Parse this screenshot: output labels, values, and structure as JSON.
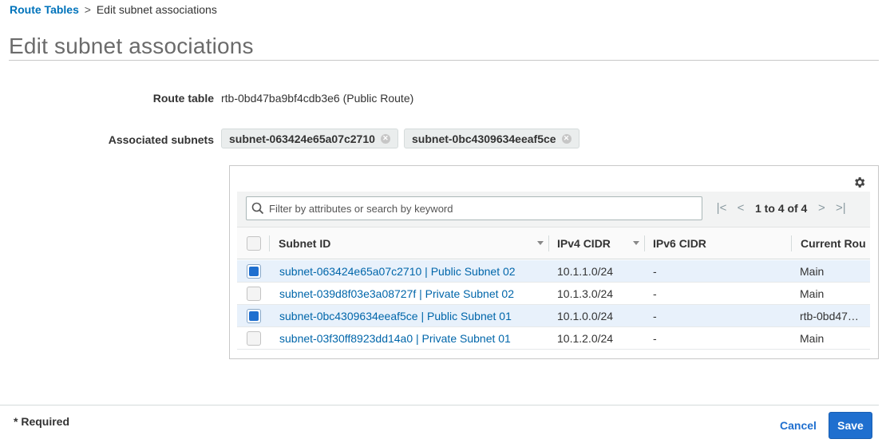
{
  "breadcrumb": {
    "parent": "Route Tables",
    "separator": ">",
    "current": "Edit subnet associations"
  },
  "page_title": "Edit subnet associations",
  "route_table": {
    "label": "Route table",
    "value": "rtb-0bd47ba9bf4cdb3e6 (Public Route)"
  },
  "associated_subnets": {
    "label": "Associated subnets",
    "tokens": [
      "subnet-063424e65a07c2710",
      "subnet-0bc4309634eeaf5ce"
    ]
  },
  "table": {
    "search_placeholder": "Filter by attributes or search by keyword",
    "pagination": "1 to 4 of 4",
    "columns": [
      "Subnet ID",
      "IPv4 CIDR",
      "IPv6 CIDR",
      "Current Route Table"
    ],
    "column_visible_text": [
      "Subnet ID",
      "IPv4 CIDR",
      "IPv6 CIDR",
      "Current Rou"
    ],
    "rows": [
      {
        "selected": true,
        "subnet": "subnet-063424e65a07c2710 | Public Subnet 02",
        "ipv4": "10.1.1.0/24",
        "ipv6": "-",
        "route": "Main"
      },
      {
        "selected": false,
        "subnet": "subnet-039d8f03e3a08727f | Private Subnet 02",
        "ipv4": "10.1.3.0/24",
        "ipv6": "-",
        "route": "Main"
      },
      {
        "selected": true,
        "subnet": "subnet-0bc4309634eeaf5ce | Public Subnet 01",
        "ipv4": "10.1.0.0/24",
        "ipv6": "-",
        "route": "rtb-0bd47…"
      },
      {
        "selected": false,
        "subnet": "subnet-03f30ff8923dd14a0 | Private Subnet 01",
        "ipv4": "10.1.2.0/24",
        "ipv6": "-",
        "route": "Main"
      }
    ]
  },
  "footer": {
    "required_note": "* Required",
    "cancel_label": "Cancel",
    "save_label": "Save"
  },
  "colors": {
    "link": "#0073bb",
    "primary_button": "#1f6fcf",
    "selected_row": "#e8f1fb"
  },
  "icons": [
    "settings-gear-icon",
    "search-icon",
    "remove-token-icon",
    "first-page-icon",
    "prev-page-icon",
    "next-page-icon",
    "last-page-icon",
    "sort-caret-icon"
  ]
}
